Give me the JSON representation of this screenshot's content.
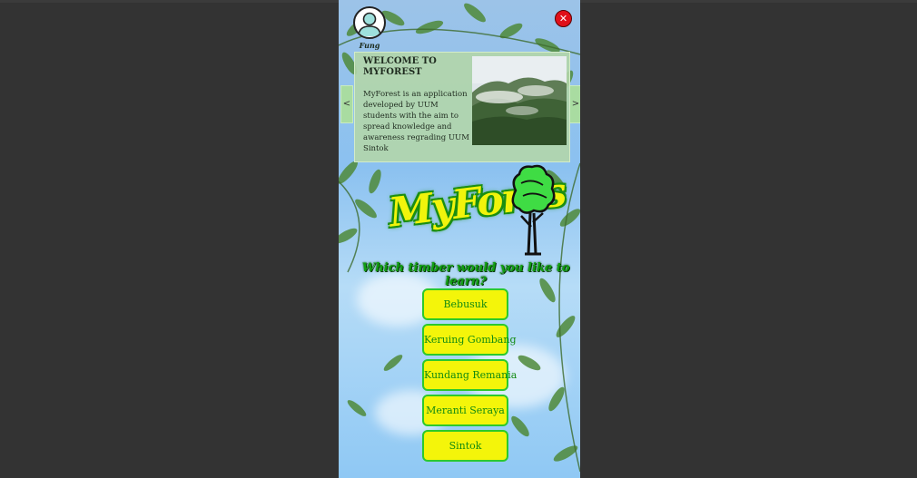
{
  "user": {
    "name": "Fung"
  },
  "welcome": {
    "title": "WELCOME TO MYFOREST",
    "body": "MyForest is an application developed by UUM students with the aim to spread knowledge and awareness regrading UUM Sintok",
    "prev_arrow": "<",
    "next_arrow": ">"
  },
  "logo": {
    "text": "MyFores"
  },
  "question": "Which timber would you like to learn?",
  "timbers": [
    "Bebusuk",
    "Keruing Gombang",
    "Kundang Remania",
    "Meranti Seraya",
    "Sintok"
  ],
  "close": {
    "symbol": "✕"
  },
  "colors": {
    "background": "#333333",
    "button_fill": "#f4f50a",
    "button_border": "#2cc92c",
    "button_text": "#128a12",
    "logo_fill": "#f1f40c",
    "close": "#e0101a"
  },
  "icons": {
    "user": "user-avatar-icon",
    "close": "close-icon",
    "tree": "tree-icon"
  }
}
